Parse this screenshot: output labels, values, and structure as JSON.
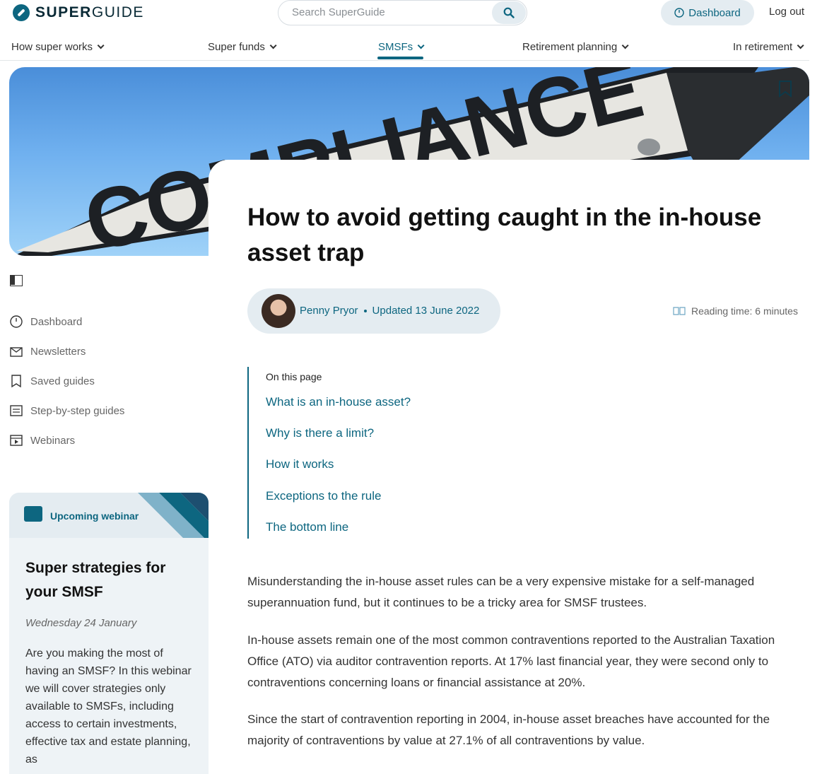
{
  "brand": {
    "logo_text_bold": "SUPER",
    "logo_text_light": "GUIDE"
  },
  "search": {
    "placeholder": "Search SuperGuide"
  },
  "header": {
    "dashboard_label": "Dashboard",
    "logout_label": "Log out"
  },
  "nav": {
    "items": [
      {
        "label": "How super works"
      },
      {
        "label": "Super funds"
      },
      {
        "label": "SMSFs"
      },
      {
        "label": "Retirement planning"
      },
      {
        "label": "In retirement"
      }
    ]
  },
  "article": {
    "title": "How to avoid getting caught in the in-house asset trap",
    "author": "Penny Pryor",
    "updated": "Updated 13 June 2022",
    "reading_time": "Reading time: 6 minutes",
    "hero_sign_text": "COMPLIANCE"
  },
  "toc": {
    "heading": "On this page",
    "links": [
      "What is an in-house asset?",
      "Why is there a limit?",
      "How it works",
      "Exceptions to the rule",
      "The bottom line"
    ]
  },
  "body": {
    "paragraphs": [
      "Misunderstanding the in-house asset rules can be a very expensive mistake for a self-managed superannuation fund, but it continues to be a tricky area for SMSF trustees.",
      "In-house assets remain one of the most common contraventions reported to the Australian Taxation Office (ATO) via auditor contravention reports. At 17% last financial year, they were second only to contraventions concerning loans or financial assistance at 20%.",
      "Since the start of contravention reporting in 2004, in-house asset breaches have accounted for the majority of contraventions by value at 27.1% of all contraventions by value."
    ]
  },
  "sidebar": {
    "items": [
      {
        "label": "Dashboard",
        "icon": "dashboard-icon"
      },
      {
        "label": "Newsletters",
        "icon": "newsletter-icon"
      },
      {
        "label": "Saved guides",
        "icon": "bookmark-icon"
      },
      {
        "label": "Step-by-step guides",
        "icon": "checklist-icon"
      },
      {
        "label": "Webinars",
        "icon": "webinar-icon"
      }
    ]
  },
  "webinar": {
    "label": "Upcoming webinar",
    "title": "Super strategies for your SMSF",
    "date": "Wednesday 24 January",
    "description": "Are you making the most of having an SMSF? In this webinar we will cover strategies only available to SMSFs, including access to certain investments, effective tax and estate planning, as"
  },
  "colors": {
    "accent": "#0d6680",
    "pill_bg": "#e4ecf1",
    "card_bg": "#eef3f6"
  }
}
